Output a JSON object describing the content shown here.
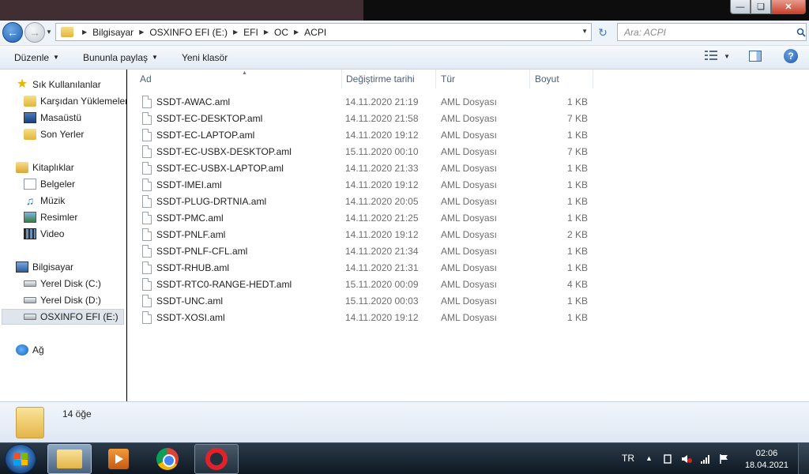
{
  "window": {
    "minimize_icon": "minimize-icon",
    "maximize_icon": "maximize-icon",
    "close_icon": "close-icon"
  },
  "address": {
    "crumbs": [
      "Bilgisayar",
      "OSXINFO EFI (E:)",
      "EFI",
      "OC",
      "ACPI"
    ],
    "search_placeholder": "Ara: ACPI"
  },
  "toolbar": {
    "organize_label": "Düzenle",
    "share_label": "Bununla paylaş",
    "new_folder_label": "Yeni klasör"
  },
  "sidebar": {
    "favorites_label": "Sık Kullanılanlar",
    "favorites": [
      "Karşıdan Yüklemeler",
      "Masaüstü",
      "Son Yerler"
    ],
    "libraries_label": "Kitaplıklar",
    "libraries": [
      "Belgeler",
      "Müzik",
      "Resimler",
      "Video"
    ],
    "computer_label": "Bilgisayar",
    "drives": [
      "Yerel Disk (C:)",
      "Yerel Disk (D:)",
      "OSXINFO EFI (E:)"
    ],
    "network_label": "Ağ"
  },
  "columns": {
    "name": "Ad",
    "date": "Değiştirme tarihi",
    "type": "Tür",
    "size": "Boyut"
  },
  "files": [
    {
      "name": "SSDT-AWAC.aml",
      "date": "14.11.2020 21:19",
      "type": "AML Dosyası",
      "size": "1 KB"
    },
    {
      "name": "SSDT-EC-DESKTOP.aml",
      "date": "14.11.2020 21:58",
      "type": "AML Dosyası",
      "size": "7 KB"
    },
    {
      "name": "SSDT-EC-LAPTOP.aml",
      "date": "14.11.2020 19:12",
      "type": "AML Dosyası",
      "size": "1 KB"
    },
    {
      "name": "SSDT-EC-USBX-DESKTOP.aml",
      "date": "15.11.2020 00:10",
      "type": "AML Dosyası",
      "size": "7 KB"
    },
    {
      "name": "SSDT-EC-USBX-LAPTOP.aml",
      "date": "14.11.2020 21:33",
      "type": "AML Dosyası",
      "size": "1 KB"
    },
    {
      "name": "SSDT-IMEI.aml",
      "date": "14.11.2020 19:12",
      "type": "AML Dosyası",
      "size": "1 KB"
    },
    {
      "name": "SSDT-PLUG-DRTNIA.aml",
      "date": "14.11.2020 20:05",
      "type": "AML Dosyası",
      "size": "1 KB"
    },
    {
      "name": "SSDT-PMC.aml",
      "date": "14.11.2020 21:25",
      "type": "AML Dosyası",
      "size": "1 KB"
    },
    {
      "name": "SSDT-PNLF.aml",
      "date": "14.11.2020 19:12",
      "type": "AML Dosyası",
      "size": "2 KB"
    },
    {
      "name": "SSDT-PNLF-CFL.aml",
      "date": "14.11.2020 21:34",
      "type": "AML Dosyası",
      "size": "1 KB"
    },
    {
      "name": "SSDT-RHUB.aml",
      "date": "14.11.2020 21:31",
      "type": "AML Dosyası",
      "size": "1 KB"
    },
    {
      "name": "SSDT-RTC0-RANGE-HEDT.aml",
      "date": "15.11.2020 00:09",
      "type": "AML Dosyası",
      "size": "4 KB"
    },
    {
      "name": "SSDT-UNC.aml",
      "date": "15.11.2020 00:03",
      "type": "AML Dosyası",
      "size": "1 KB"
    },
    {
      "name": "SSDT-XOSI.aml",
      "date": "14.11.2020 19:12",
      "type": "AML Dosyası",
      "size": "1 KB"
    }
  ],
  "details": {
    "count_text": "14 öğe"
  },
  "taskbar": {
    "apps": [
      "explorer-icon",
      "media-player-icon",
      "chrome-icon",
      "opera-icon"
    ],
    "language": "TR",
    "time": "02:06",
    "date": "18.04.2021"
  },
  "colors": {
    "accent": "#1d5fb3",
    "selected_row": "#dfe5ec",
    "header_text": "#4c607a"
  }
}
